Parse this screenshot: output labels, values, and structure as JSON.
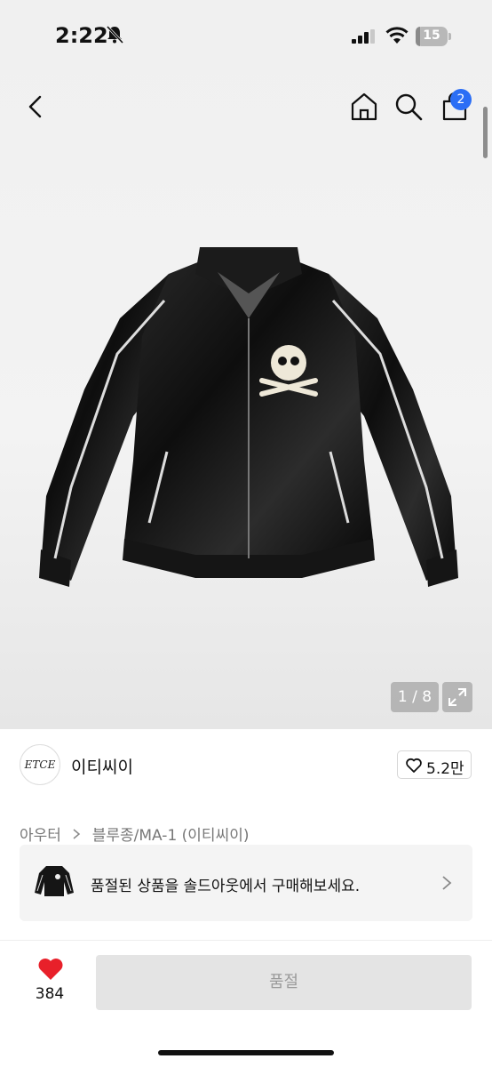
{
  "status_bar": {
    "time": "2:22",
    "battery": "15",
    "battery_level": 0.15
  },
  "nav": {
    "cart_badge": "2"
  },
  "gallery": {
    "counter": "1 / 8"
  },
  "brand": {
    "logo_text": "ETCE",
    "name": "이티씨이",
    "likes": "5.2만"
  },
  "breadcrumb": {
    "category": "아우터",
    "subcategory": "블루종/MA-1 (이티씨이)"
  },
  "soldout_banner": {
    "text": "품절된 상품을 솔드아웃에서 구매해보세요."
  },
  "bottom_bar": {
    "wish_count": "384",
    "buy_button_label": "품절"
  },
  "colors": {
    "accent_blue": "#2b6ef5",
    "heart_red": "#e8202a",
    "disabled_button": "#e4e4e4"
  }
}
